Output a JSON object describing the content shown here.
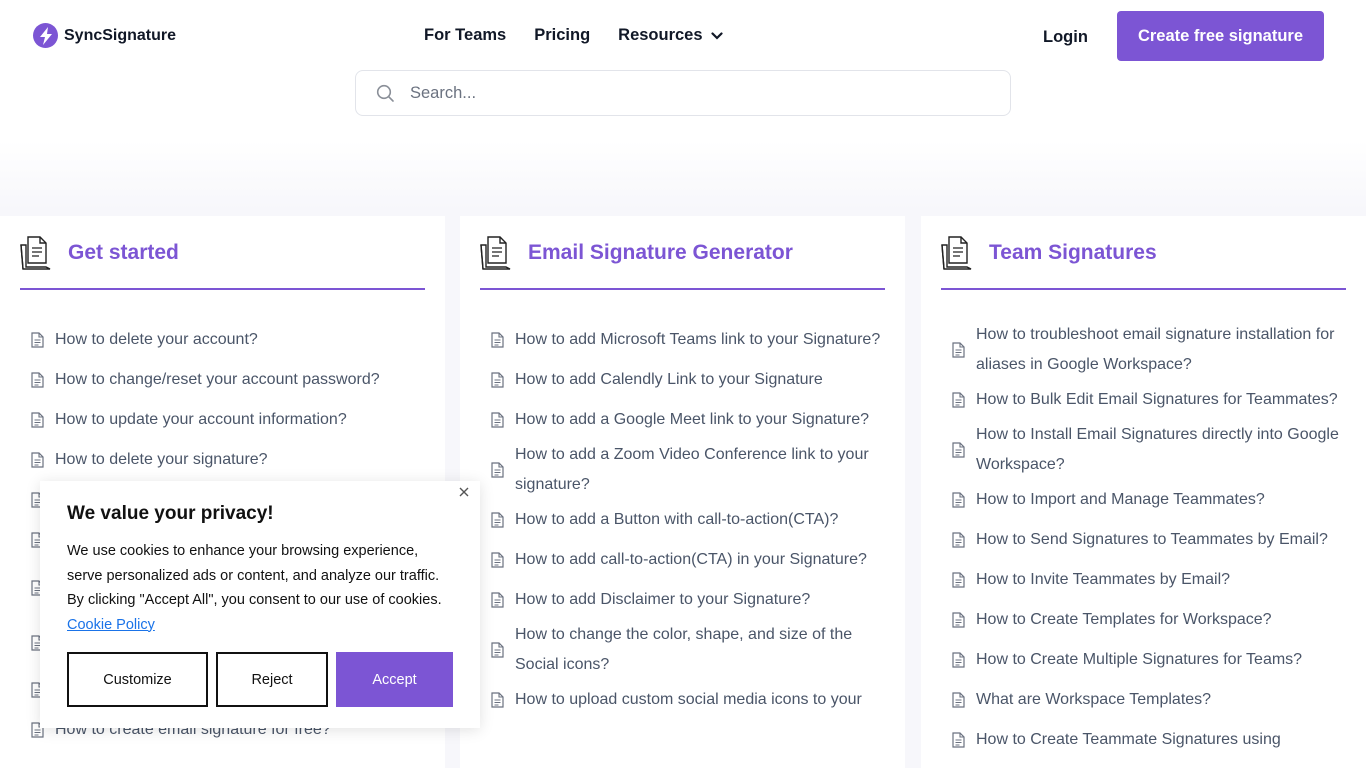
{
  "header": {
    "brand": "SyncSignature",
    "nav": [
      {
        "label": "For Teams"
      },
      {
        "label": "Pricing"
      },
      {
        "label": "Resources"
      }
    ],
    "login_label": "Login",
    "cta_label": "Create free signature",
    "accent_color": "#7c55d4"
  },
  "search": {
    "placeholder": "Search...",
    "value": ""
  },
  "categories": [
    {
      "title": "Get started",
      "articles": [
        "How to delete your account?",
        "How to change/reset your account password?",
        "How to update your account information?",
        "How to delete your signature?",
        "",
        "",
        "",
        "",
        "",
        "How to create email signature for free?"
      ]
    },
    {
      "title": "Email Signature Generator",
      "articles": [
        "How to add Microsoft Teams link to your Signature?",
        "How to add Calendly Link to your Signature",
        "How to add a Google Meet link to your Signature?",
        "How to add a Zoom Video Conference link to your signature?",
        "How to add a Button with call-to-action(CTA)?",
        "How to add call-to-action(CTA) in your Signature?",
        "How to add Disclaimer to your Signature?",
        "How to change the color, shape, and size of the Social icons?",
        "How to upload custom social media icons to your"
      ]
    },
    {
      "title": "Team Signatures",
      "articles": [
        "How to troubleshoot email signature installation for aliases in Google Workspace?",
        "How to Bulk Edit Email Signatures for Teammates?",
        "How to Install Email Signatures directly into Google Workspace?",
        "How to Import and Manage Teammates?",
        "How to Send Signatures to Teammates by Email?",
        "How to Invite Teammates by Email?",
        "How to Create Templates for Workspace?",
        "How to Create Multiple Signatures for Teams?",
        "What are Workspace Templates?",
        "How to Create Teammate Signatures using"
      ]
    }
  ],
  "cookie": {
    "title": "We value your privacy!",
    "body": "We use cookies to enhance your browsing experience, serve personalized ads or content, and analyze our traffic. By clicking \"Accept All\", you consent to our use of cookies.",
    "link": "Cookie Policy",
    "customize": "Customize",
    "reject": "Reject",
    "accept": "Accept"
  }
}
